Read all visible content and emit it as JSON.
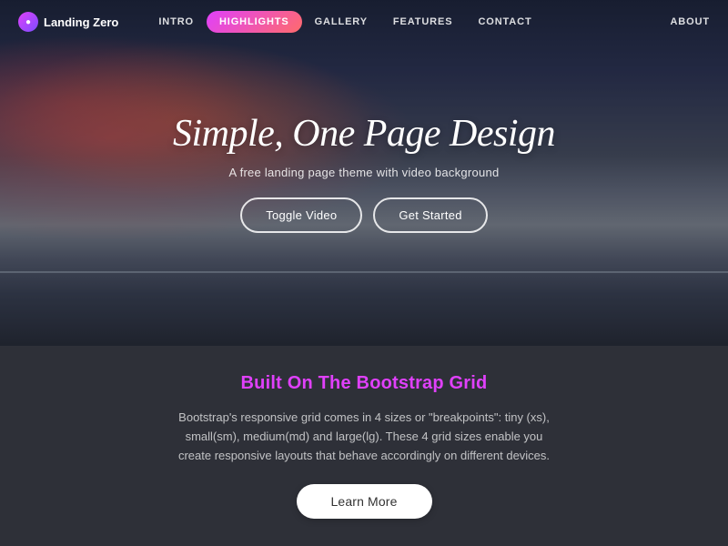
{
  "nav": {
    "logo_text": "Landing Zero",
    "links": [
      {
        "label": "INTRO",
        "active": false
      },
      {
        "label": "HIGHLIGHTS",
        "active": true
      },
      {
        "label": "GALLERY",
        "active": false
      },
      {
        "label": "FEATURES",
        "active": false
      },
      {
        "label": "CONTACT",
        "active": false
      }
    ],
    "right_link": "ABOUT"
  },
  "hero": {
    "title": "Simple, One Page Design",
    "subtitle": "A free landing page theme with video background",
    "btn_toggle": "Toggle Video",
    "btn_start": "Get Started"
  },
  "section": {
    "title": "Built On The Bootstrap Grid",
    "body": "Bootstrap's responsive grid comes in 4 sizes or \"breakpoints\": tiny (xs), small(sm), medium(md) and large(lg). These 4 grid sizes enable you create responsive layouts that behave accordingly on different devices.",
    "btn_learn": "Learn More"
  }
}
